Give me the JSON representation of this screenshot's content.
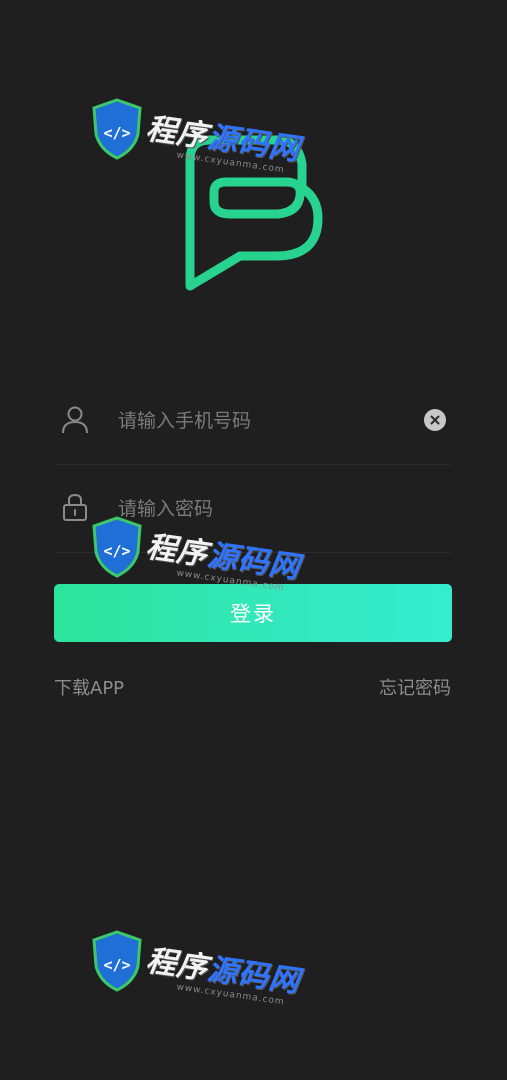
{
  "colors": {
    "background": "#1f1f1f",
    "accent_start": "#2ee39a",
    "accent_end": "#34ecd0",
    "logo_green": "#27d38f"
  },
  "logo": {
    "icon": "speech-bubble-logo-icon"
  },
  "phone_field": {
    "icon": "user-icon",
    "placeholder": "请输入手机号码",
    "value": "",
    "clear_icon": "clear-circle-x-icon"
  },
  "password_field": {
    "icon": "lock-icon",
    "placeholder": "请输入密码",
    "value": ""
  },
  "login_button": {
    "label": "登录"
  },
  "links": {
    "download_label": "下载APP",
    "forgot_label": "忘记密码"
  },
  "watermark": {
    "part1": "程序",
    "part2": "源码网",
    "url": "www.cxyuanma.com",
    "icon": "code-shield-icon"
  }
}
